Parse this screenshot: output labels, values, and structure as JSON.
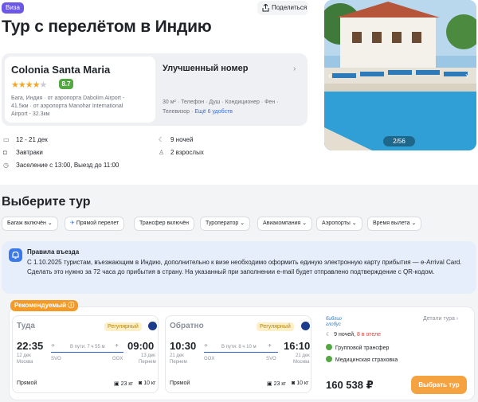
{
  "header": {
    "visa_badge": "Виза",
    "share_label": "Поделиться",
    "title": "Тур с перелётом в Индию"
  },
  "hotel": {
    "name": "Colonia Santa Maria",
    "stars": 4,
    "rating": "8.7",
    "address_line1": "Бага, Индия · от аэропорта Dabolim Airport -",
    "address_line2": "41.5км · от аэропорта Manohar International",
    "address_line3": "Airport - 32.3км"
  },
  "room": {
    "title": "Улучшенный номер",
    "amenities_line1": "30 м² · Телефон · Душ · Кондиционер · Фен ·",
    "amenities_line2": "Телевизор",
    "more_link": "Ещё 6 удобств"
  },
  "photo": {
    "counter": "2/56"
  },
  "trip": {
    "dates": "12 - 21 дек",
    "nights": "9 ночей",
    "meals": "Завтраки",
    "guests": "2 взрослых",
    "checkin": "Заселение с 13:00, Выезд до 11:00"
  },
  "tours": {
    "section_title": "Выберите тур",
    "filters": [
      "Багаж включён",
      "Прямой перелет",
      "Трансфер включён",
      "Туроператор",
      "Авиакомпания",
      "Аэропорты",
      "Время вылета"
    ]
  },
  "rules": {
    "title": "Правила въезда",
    "text": "С 1.10.2025 туристам, въезжающим в Индию, дополнительно к визе необходимо оформить единую электронную карту прибытия — e-Arrival Card. Сделать это нужно за 72 часа до прибытия в страну. На указанный при заполнении e-mail будет отправлено подтверждение с QR-кодом."
  },
  "offer": {
    "recommended": "Рекомендуемый",
    "outbound": {
      "title": "Туда",
      "regular": "Регулярный",
      "dep_time": "22:35",
      "dep_date": "12 дек",
      "dep_city": "Москва",
      "dep_code": "SVO",
      "duration": "В пути: 7 ч 55 м",
      "arr_code": "GOX",
      "arr_time": "09:00",
      "arr_date": "13 дек",
      "arr_city": "Пернем",
      "direct": "Прямой",
      "baggage": "23 кг",
      "handbag": "10 кг"
    },
    "return": {
      "title": "Обратно",
      "regular": "Регулярный",
      "dep_time": "10:30",
      "dep_date": "21 дек",
      "dep_city": "Пернем",
      "dep_code": "GOX",
      "duration": "В пути: 8 ч 10 м",
      "arr_code": "SVO",
      "arr_time": "16:10",
      "arr_date": "21 дек",
      "arr_city": "Москва",
      "direct": "Прямой",
      "baggage": "23 кг",
      "handbag": "10 кг"
    },
    "operator_line1": "библио",
    "operator_line2": "глобус",
    "details_link": "Детали тура",
    "nights": "9 ночей,",
    "hotel_nights": "8 в отеле",
    "transfer": "Групповой трансфер",
    "insurance": "Медицинская страховка",
    "price": "160 538 ₽",
    "book_label": "Выбрать тур"
  }
}
